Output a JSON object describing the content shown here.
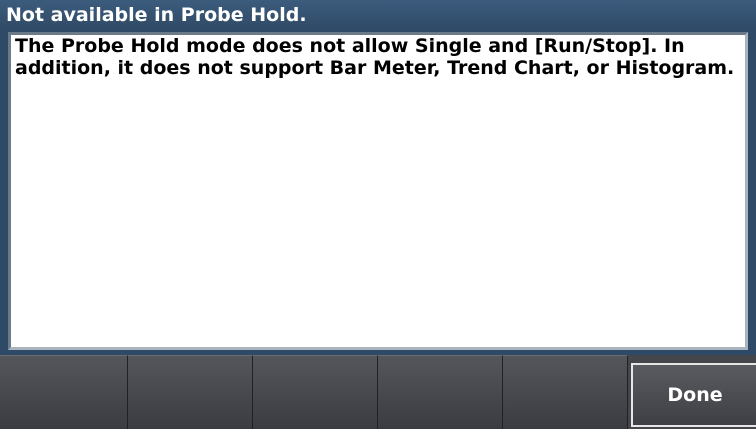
{
  "dialog": {
    "title": "Not available in Probe Hold.",
    "message": "The Probe Hold mode does not allow Single and [Run/Stop]. In\naddition, it does not support Bar Meter, Trend Chart, or Histogram."
  },
  "softkeys": {
    "key1": "",
    "key2": "",
    "key3": "",
    "key4": "",
    "key5": "",
    "done_label": "Done"
  },
  "colors": {
    "title_bar": "#2f4a66",
    "panel_bg": "#ffffff",
    "softkey_bg": "#45464b"
  }
}
